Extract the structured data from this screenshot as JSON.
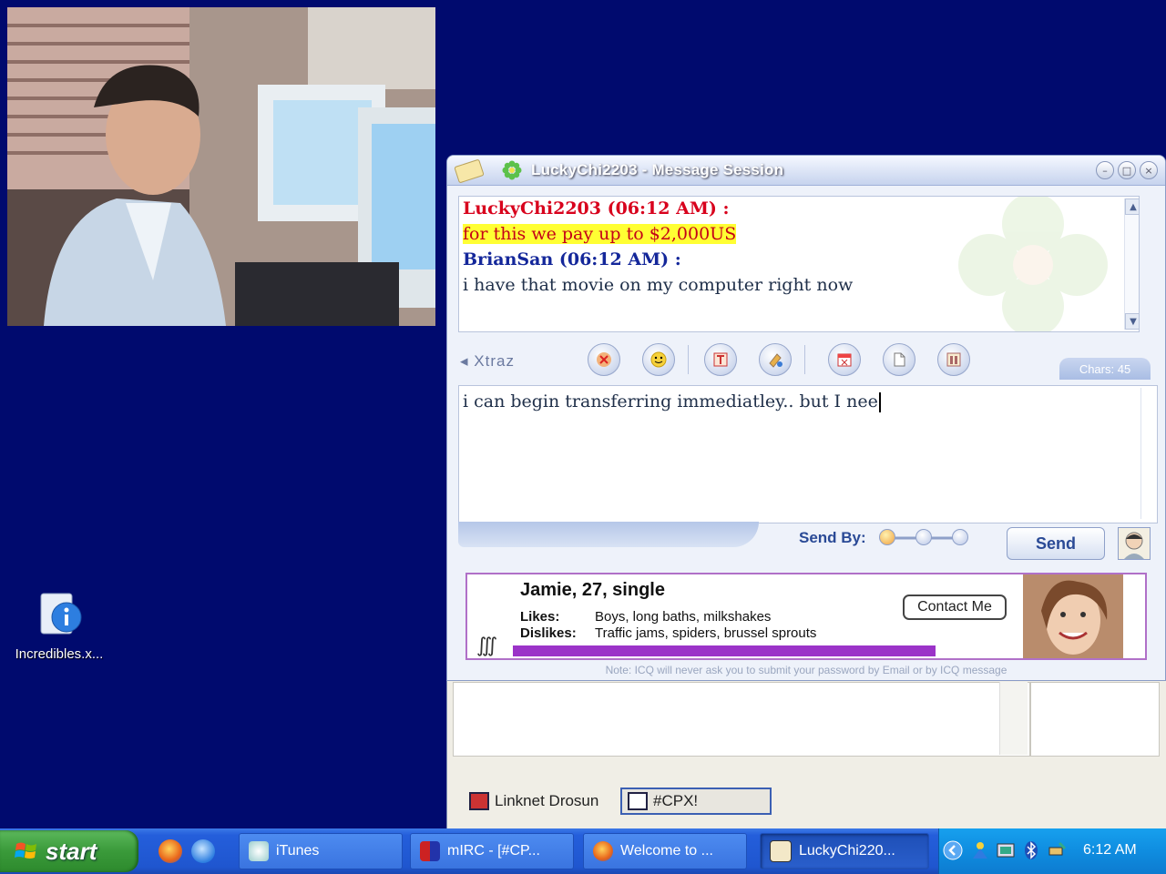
{
  "desktop": {
    "icon_label": "Incredibles.x..."
  },
  "icq": {
    "title": "LuckyChi2203 - Message Session",
    "history": [
      {
        "type": "sender",
        "style": "red",
        "text": "LuckyChi2203 (06:12 AM) :"
      },
      {
        "type": "msg",
        "style": "highlight",
        "text": "for this we pay up to $2,000US"
      },
      {
        "type": "sender",
        "style": "blue",
        "text": "BrianSan (06:12 AM) :"
      },
      {
        "type": "msg",
        "style": "plain",
        "text": "i have that movie on my computer right now"
      }
    ],
    "toolbar": {
      "xtraz_label": "Xtraz",
      "chars_label": "Chars: 45"
    },
    "compose_text": "i can begin transferring immediatley.. but I nee",
    "send_by_label": "Send By:",
    "send_label": "Send",
    "ad": {
      "name_line": "Jamie,  27,  single",
      "likes_key": "Likes:",
      "likes_value": "Boys, long baths, milkshakes",
      "dislikes_key": "Dislikes:",
      "dislikes_value": "Traffic jams, spiders, brussel sprouts",
      "contact_label": "Contact Me"
    },
    "note": "Note: ICQ will never ask you to submit your password by Email or by ICQ message"
  },
  "channels": {
    "tab1": "Linknet Drosun",
    "tab2": "#CPX!"
  },
  "taskbar": {
    "start_label": "start",
    "tasks": [
      {
        "label": "iTunes"
      },
      {
        "label": "mIRC - [#CP..."
      },
      {
        "label": "Welcome to ..."
      },
      {
        "label": "LuckyChi220..."
      }
    ],
    "clock": "6:12 AM"
  },
  "colors": {
    "desktop_bg": "#000a6e",
    "sender_red": "#d8001c",
    "sender_blue": "#14279a",
    "highlight": "#ffff33",
    "ad_border": "#b070c8",
    "taskbar": "#245edb",
    "start_green": "#3a9a3a"
  }
}
